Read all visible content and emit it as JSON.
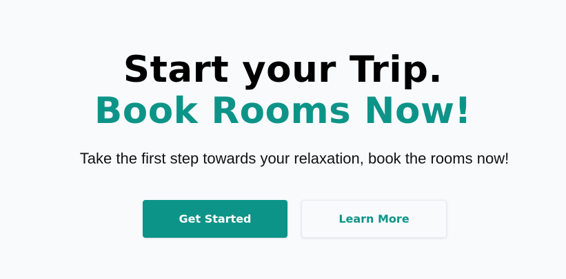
{
  "hero": {
    "headline_line1": "Start your Trip.",
    "headline_line2": "Book Rooms Now!",
    "subtitle": "Take the first step towards your relaxation, book the rooms now!",
    "primary_button": "Get Started",
    "secondary_button": "Learn More"
  },
  "colors": {
    "accent": "#0d9488",
    "background": "#f8fafc",
    "headline": "#000000"
  }
}
